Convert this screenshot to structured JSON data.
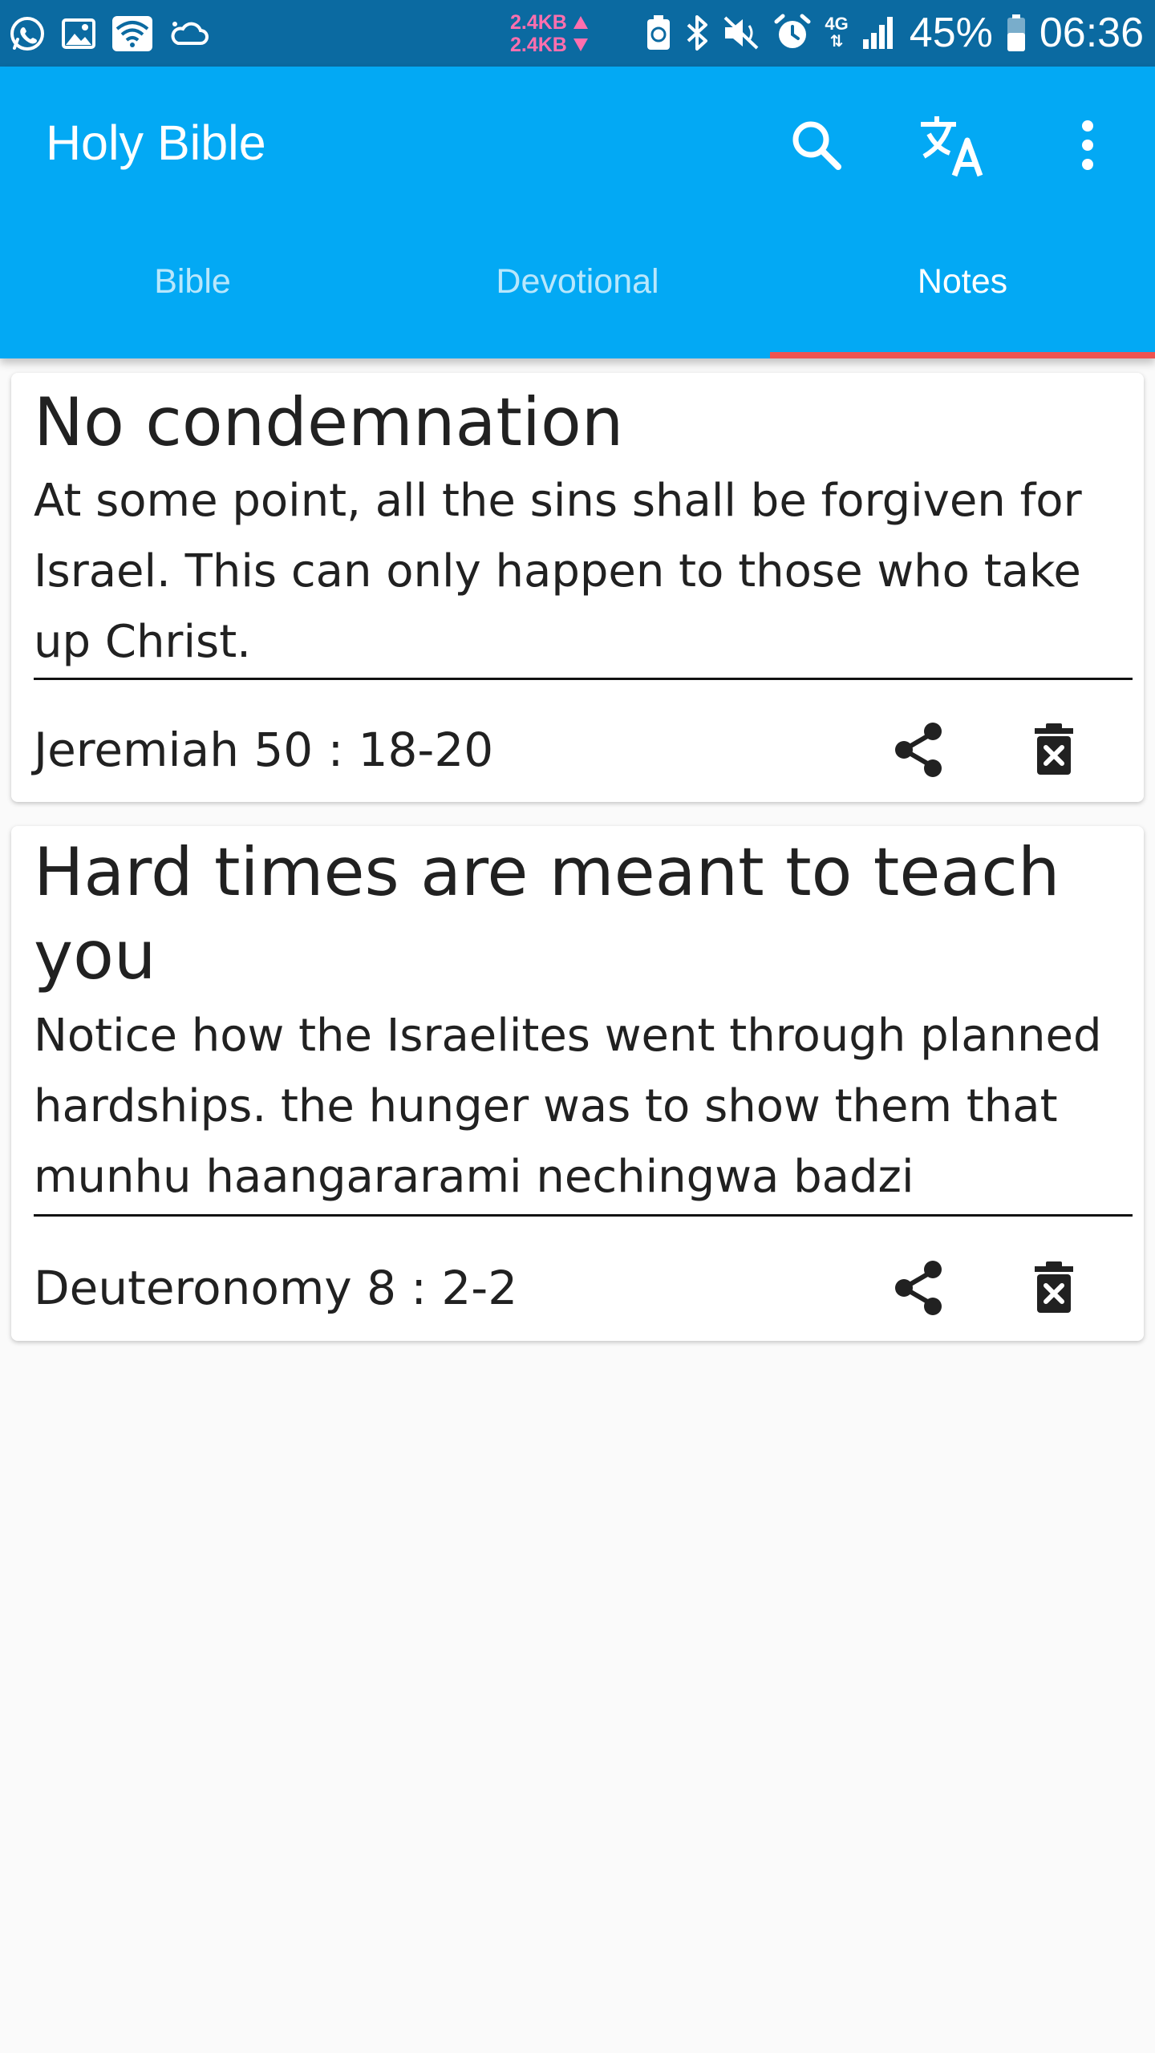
{
  "status_bar": {
    "net_up": "2.4KB",
    "net_down": "2.4KB",
    "battery": "45%",
    "time": "06:36",
    "network": "4G",
    "left_icons": [
      "whatsapp-icon",
      "gallery-icon",
      "wifi-icon",
      "cloud-icon"
    ],
    "right_icons": [
      "battery-saver-icon",
      "bluetooth-icon",
      "mute-icon",
      "alarm-icon",
      "signal-icon",
      "battery-icon"
    ]
  },
  "app_bar": {
    "title": "Holy Bible",
    "actions": [
      "search-icon",
      "translate-icon",
      "more-vert-icon"
    ],
    "background_color": "#03a9f4",
    "indicator_color": "#ef5350"
  },
  "tabs": [
    {
      "label": "Bible",
      "active": false
    },
    {
      "label": "Devotional",
      "active": false
    },
    {
      "label": "Notes",
      "active": true
    }
  ],
  "notes": [
    {
      "title": "No condemnation",
      "body": "At some point, all the sins shall be forgiven for Israel. This can only happen to those who take up Christ.",
      "reference": "Jeremiah 50 : 18-20"
    },
    {
      "title": "Hard times are meant to teach you",
      "body": "Notice how the Israelites went through planned hardships. the hunger was to show them that munhu haangararami nechingwa badzi",
      "reference": "Deuteronomy 8 : 2-2"
    }
  ]
}
